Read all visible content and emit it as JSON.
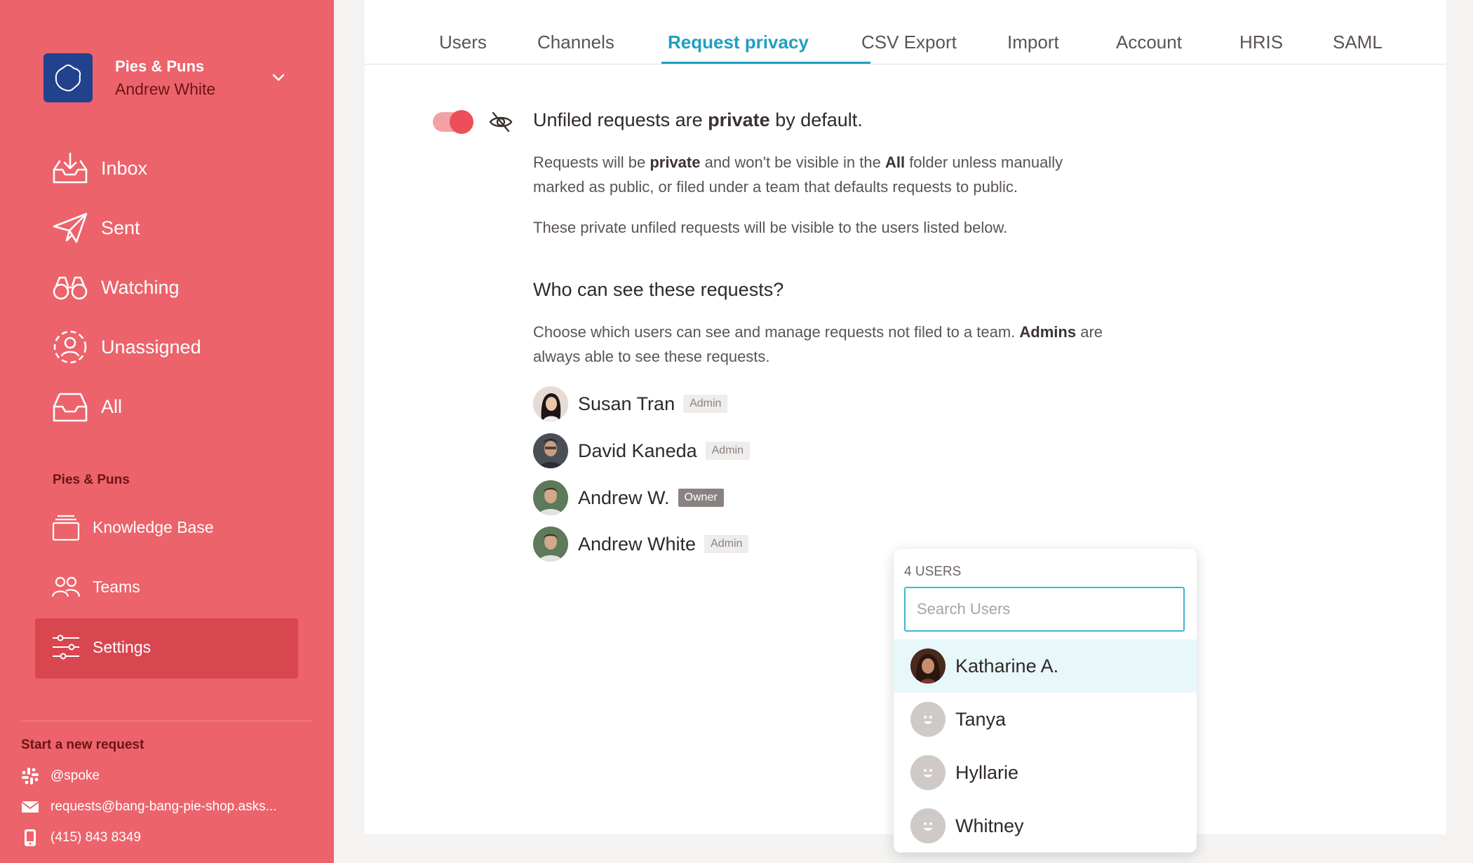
{
  "sidebar": {
    "workspace": {
      "name": "Pies & Puns",
      "user": "Andrew White"
    },
    "nav": [
      {
        "label": "Inbox",
        "icon": "inbox-icon"
      },
      {
        "label": "Sent",
        "icon": "paper-plane-icon"
      },
      {
        "label": "Watching",
        "icon": "binoculars-icon"
      },
      {
        "label": "Unassigned",
        "icon": "unassigned-user-icon"
      },
      {
        "label": "All",
        "icon": "tray-icon"
      }
    ],
    "section_label": "Pies & Puns",
    "sub_nav": [
      {
        "label": "Knowledge Base",
        "icon": "stack-icon"
      },
      {
        "label": "Teams",
        "icon": "people-icon"
      },
      {
        "label": "Settings",
        "icon": "sliders-icon",
        "active": true
      }
    ],
    "start_label": "Start a new request",
    "contacts": [
      {
        "label": "@spoke",
        "icon": "slack-icon"
      },
      {
        "label": "requests@bang-bang-pie-shop.asks...",
        "icon": "envelope-icon"
      },
      {
        "label": "(415) 843 8349",
        "icon": "phone-icon"
      }
    ]
  },
  "tabs": [
    {
      "label": "Users"
    },
    {
      "label": "Channels"
    },
    {
      "label": "Request privacy",
      "active": true
    },
    {
      "label": "CSV Export"
    },
    {
      "label": "Import"
    },
    {
      "label": "Account"
    },
    {
      "label": "HRIS"
    },
    {
      "label": "SAML"
    }
  ],
  "privacy": {
    "toggle_on": true,
    "headline_pre": "Unfiled requests are ",
    "headline_bold": "private",
    "headline_post": " by default.",
    "p1_a": "Requests will be ",
    "p1_b": "private",
    "p1_c": " and won't be visible in the ",
    "p1_d": "All",
    "p1_e": " folder unless manually",
    "p1_f": "marked as public, or filed under a team that defaults requests to public.",
    "p2": "These private unfiled requests will be visible to the users listed below.",
    "subhead": "Who can see these requests?",
    "p3_a": "Choose which users can see and manage requests not filed to a team. ",
    "p3_b": "Admins",
    "p3_c": " are",
    "p3_d": "always able to see these requests."
  },
  "members": [
    {
      "name": "Susan Tran",
      "role": "Admin"
    },
    {
      "name": "David Kaneda",
      "role": "Admin"
    },
    {
      "name": "Andrew W.",
      "role": "Owner"
    },
    {
      "name": "Andrew White",
      "role": "Admin"
    }
  ],
  "dropdown": {
    "count": "4 USERS",
    "placeholder": "Search Users",
    "items": [
      {
        "name": "Katharine A.",
        "highlighted": true
      },
      {
        "name": "Tanya"
      },
      {
        "name": "Hyllarie"
      },
      {
        "name": "Whitney"
      }
    ]
  },
  "colors": {
    "sidebar": "#ec636b",
    "sidebar_active": "#d84750",
    "accent": "#1f9fc3",
    "toggle": "#ec4f59",
    "workspace_logo": "#23428d"
  }
}
